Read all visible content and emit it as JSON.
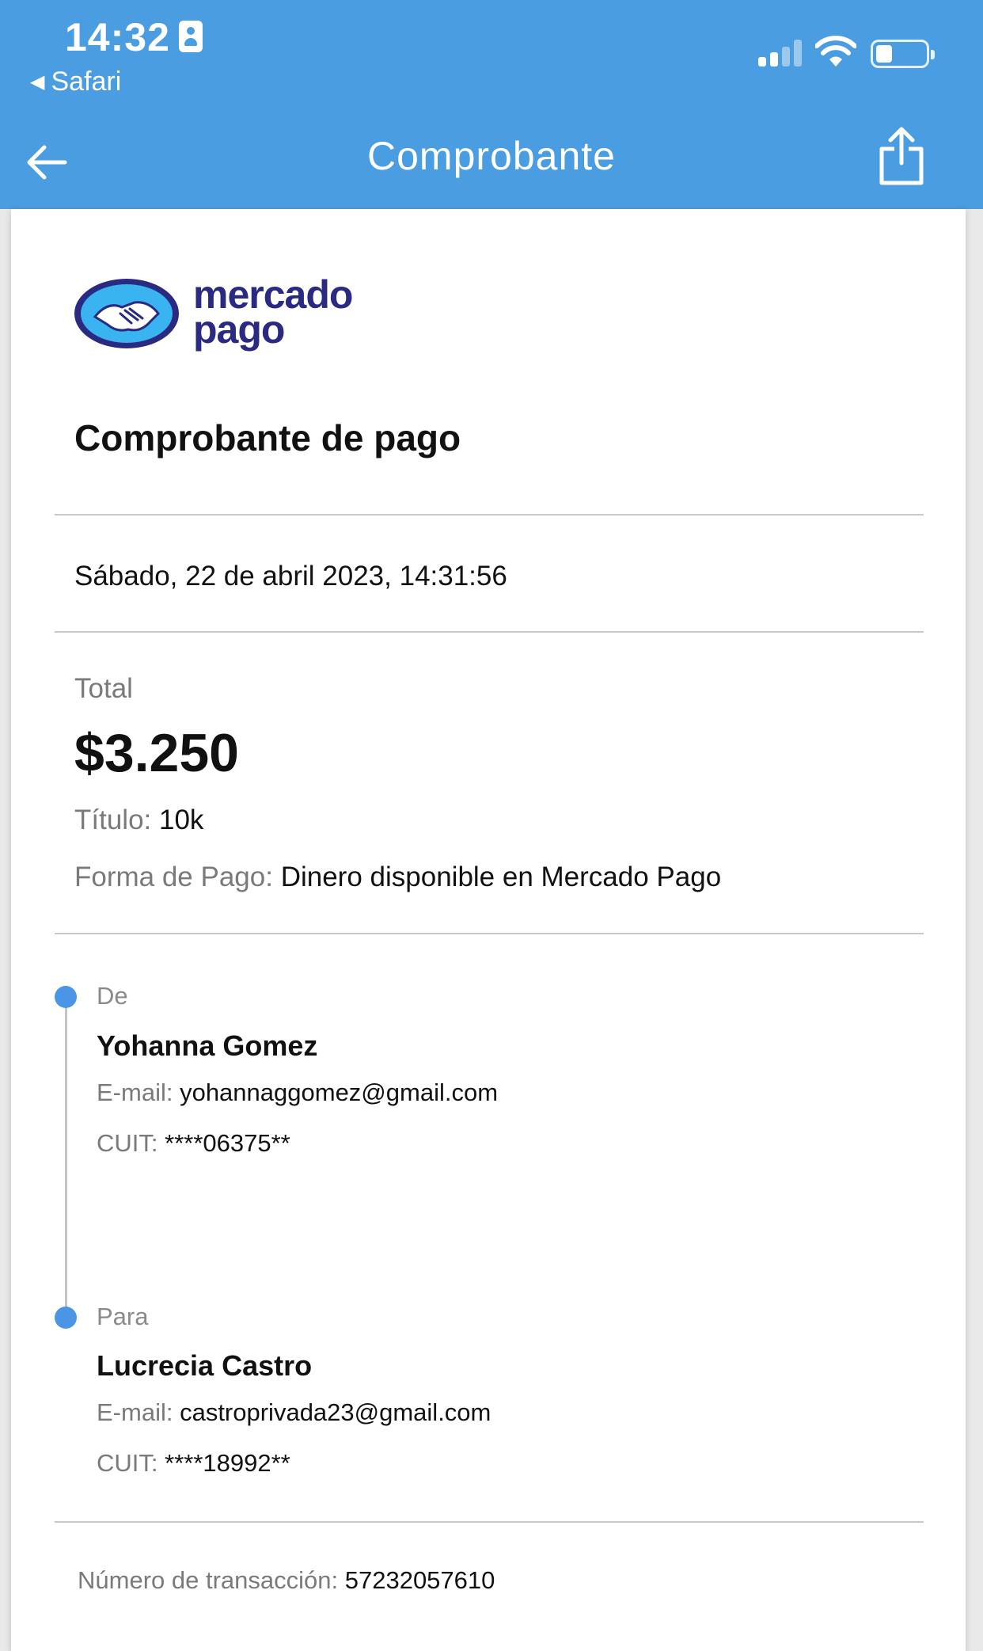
{
  "status_bar": {
    "time": "14:32",
    "back_app": "Safari"
  },
  "nav": {
    "title": "Comprobante"
  },
  "logo": {
    "line1": "mercado",
    "line2": "pago"
  },
  "receipt": {
    "title": "Comprobante de pago",
    "date": "Sábado, 22 de abril 2023, 14:31:56",
    "total_label": "Total",
    "total_amount": "$3.250",
    "titulo_label": "Título:",
    "titulo_value": "10k",
    "forma_label": "Forma de Pago:",
    "forma_value": "Dinero disponible en Mercado Pago"
  },
  "from": {
    "label": "De",
    "name": "Yohanna Gomez",
    "email_label": "E-mail:",
    "email": "yohannaggomez@gmail.com",
    "cuit_label": "CUIT:",
    "cuit": "****06375**"
  },
  "to": {
    "label": "Para",
    "name": "Lucrecia Castro",
    "email_label": "E-mail:",
    "email": "castroprivada23@gmail.com",
    "cuit_label": "CUIT:",
    "cuit": "****18992**"
  },
  "transaction": {
    "label": "Número de transacción:",
    "number": "57232057610"
  },
  "colors": {
    "header": "#4a9de0",
    "timeline_dot": "#4a95e6",
    "brand_text": "#2a2a82"
  }
}
